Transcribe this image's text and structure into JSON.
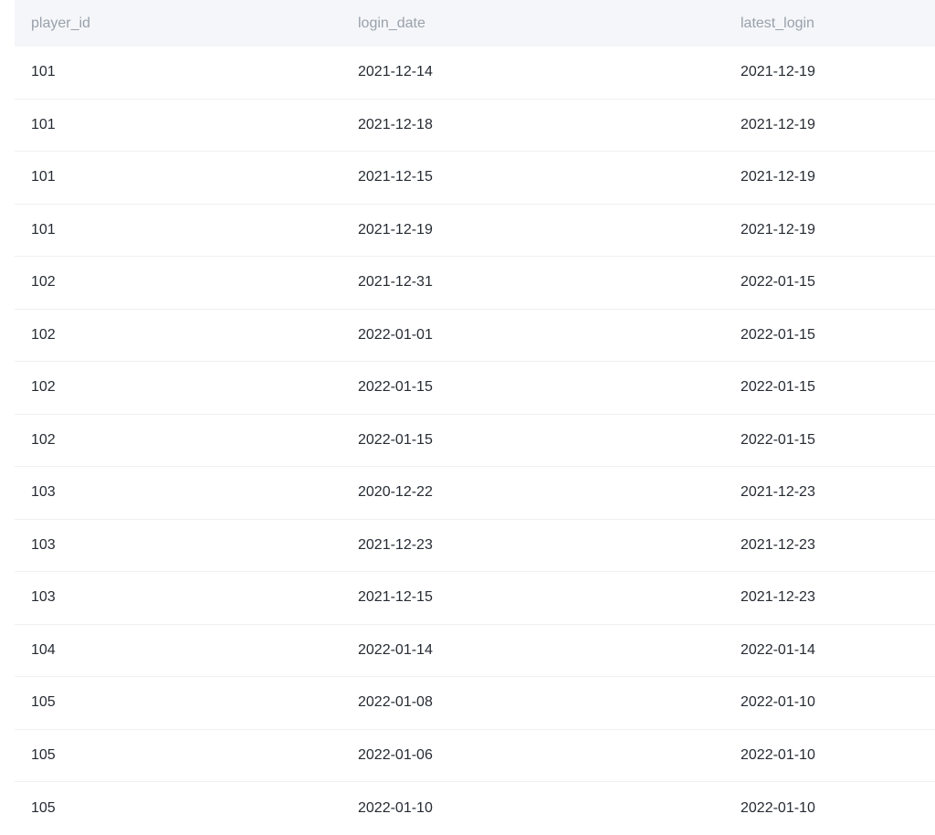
{
  "table": {
    "columns": [
      "player_id",
      "login_date",
      "latest_login"
    ],
    "rows": [
      [
        "101",
        "2021-12-14",
        "2021-12-19"
      ],
      [
        "101",
        "2021-12-18",
        "2021-12-19"
      ],
      [
        "101",
        "2021-12-15",
        "2021-12-19"
      ],
      [
        "101",
        "2021-12-19",
        "2021-12-19"
      ],
      [
        "102",
        "2021-12-31",
        "2022-01-15"
      ],
      [
        "102",
        "2022-01-01",
        "2022-01-15"
      ],
      [
        "102",
        "2022-01-15",
        "2022-01-15"
      ],
      [
        "102",
        "2022-01-15",
        "2022-01-15"
      ],
      [
        "103",
        "2020-12-22",
        "2021-12-23"
      ],
      [
        "103",
        "2021-12-23",
        "2021-12-23"
      ],
      [
        "103",
        "2021-12-15",
        "2021-12-23"
      ],
      [
        "104",
        "2022-01-14",
        "2022-01-14"
      ],
      [
        "105",
        "2022-01-08",
        "2022-01-10"
      ],
      [
        "105",
        "2022-01-06",
        "2022-01-10"
      ],
      [
        "105",
        "2022-01-10",
        "2022-01-10"
      ]
    ]
  },
  "colors": {
    "header_bg": "#f4f6f9",
    "header_text": "#9aa1ab",
    "cell_text": "#262b33",
    "divider": "#eef0f3"
  }
}
